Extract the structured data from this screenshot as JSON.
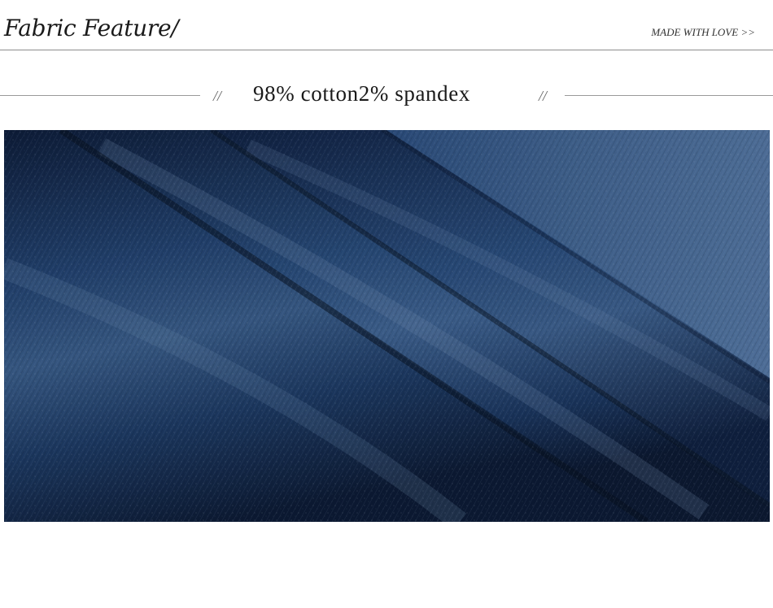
{
  "header": {
    "title": "Fabric Feature/",
    "tag": "MADE WITH LOVE >>"
  },
  "subheading": {
    "slash_left": "//",
    "text": "98% cotton2% spandex",
    "slash_right": "//"
  },
  "photo": {
    "subject": "denim fabric folds",
    "colors": {
      "deep": "#0f1f3d",
      "mid": "#22406c",
      "light": "#4f6f97",
      "highlight": "#8aa0bb"
    }
  }
}
